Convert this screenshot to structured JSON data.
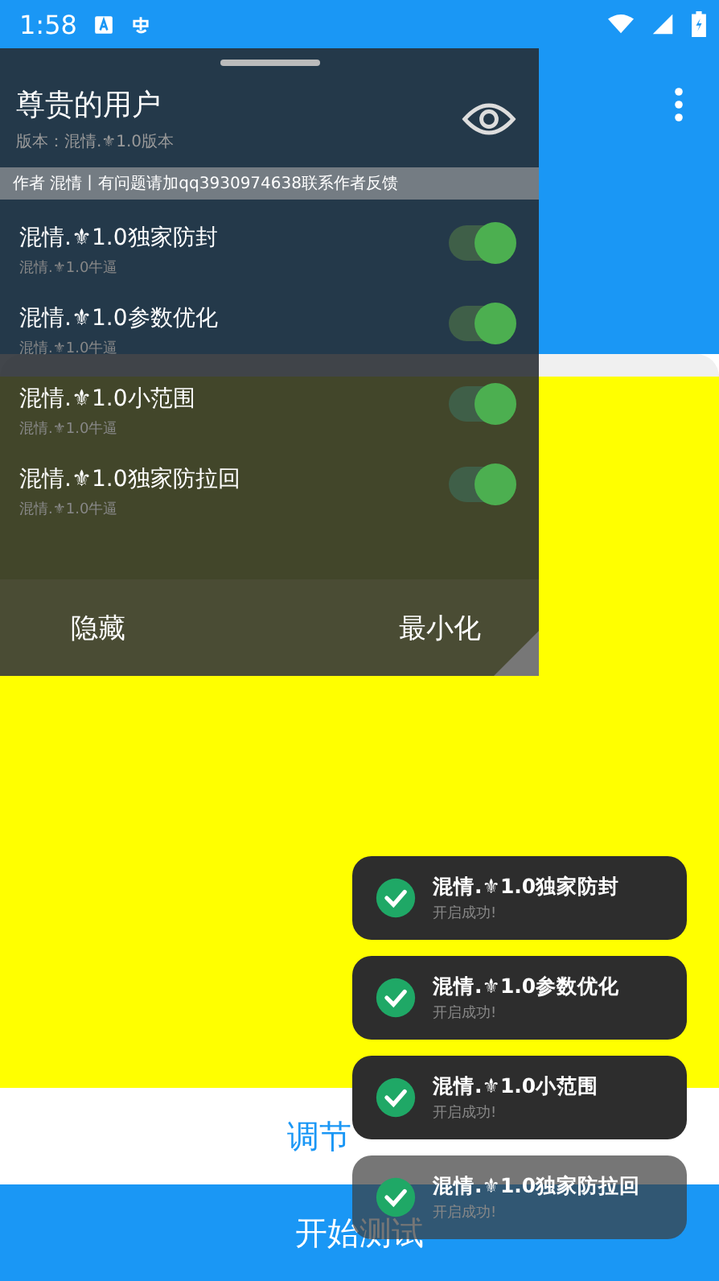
{
  "status_bar": {
    "time": "1:58"
  },
  "app": {
    "adjust_button": "调节",
    "start_button": "开始测试"
  },
  "panel": {
    "title": "尊贵的用户",
    "version": "版本：混情.⚜1.0版本",
    "notice": "作者 混情丨有问题请加qq3930974638联系作者反馈",
    "options": [
      {
        "label": "混情.⚜1.0独家防封",
        "sub": "混情.⚜1.0牛逼",
        "on": true
      },
      {
        "label": "混情.⚜1.0参数优化",
        "sub": "混情.⚜1.0牛逼",
        "on": true
      },
      {
        "label": "混情.⚜1.0小范围",
        "sub": "混情.⚜1.0牛逼",
        "on": true
      },
      {
        "label": "混情.⚜1.0独家防拉回",
        "sub": "混情.⚜1.0牛逼",
        "on": true
      }
    ],
    "buttons": [
      "隐藏",
      "最小化"
    ]
  },
  "toasts": [
    {
      "title": "混情.⚜1.0独家防封",
      "message": "开启成功!",
      "fading": false
    },
    {
      "title": "混情.⚜1.0参数优化",
      "message": "开启成功!",
      "fading": false
    },
    {
      "title": "混情.⚜1.0小范围",
      "message": "开启成功!",
      "fading": false
    },
    {
      "title": "混情.⚜1.0独家防拉回",
      "message": "开启成功!",
      "fading": true
    }
  ]
}
